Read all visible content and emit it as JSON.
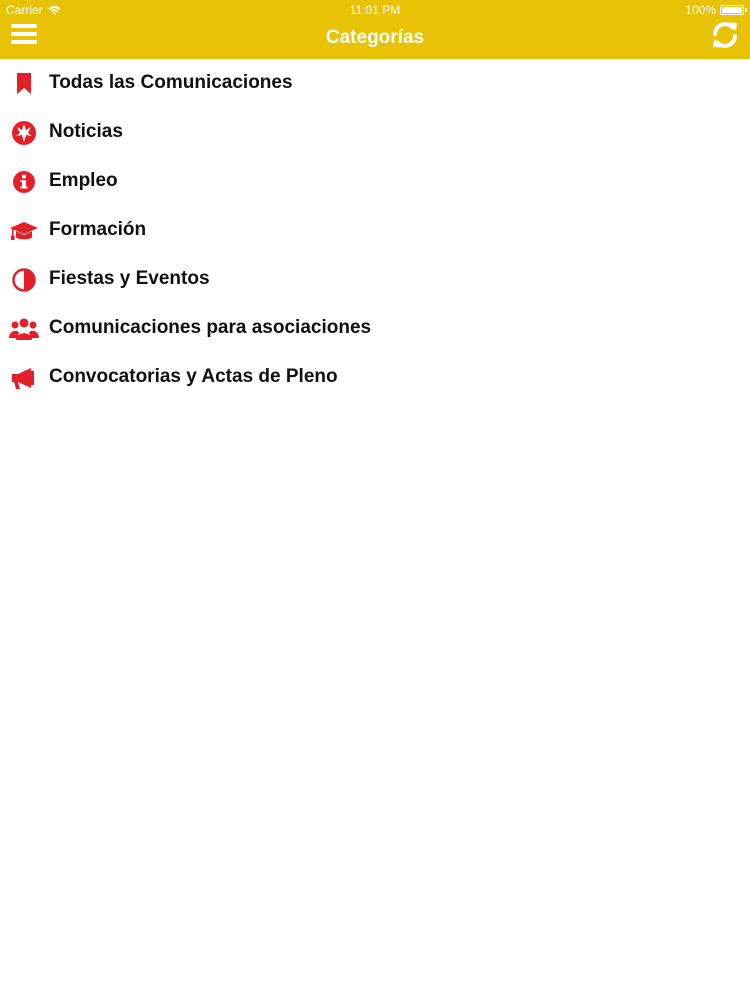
{
  "status_bar": {
    "carrier": "Carrier",
    "time": "11:01 PM",
    "battery": "100%"
  },
  "navbar": {
    "title": "Categorías",
    "menu_icon": "hamburger-menu-icon",
    "refresh_icon": "refresh-icon"
  },
  "colors": {
    "accent": "#E8C204",
    "icon": "#E3202A",
    "text": "#111111"
  },
  "categories": [
    {
      "label": "Todas las Comunicaciones",
      "icon": "bookmark-icon"
    },
    {
      "label": "Noticias",
      "icon": "rebel-emblem-icon"
    },
    {
      "label": "Empleo",
      "icon": "info-circle-icon"
    },
    {
      "label": "Formación",
      "icon": "graduation-cap-icon"
    },
    {
      "label": "Fiestas y Eventos",
      "icon": "half-circle-icon"
    },
    {
      "label": "Comunicaciones para asociaciones",
      "icon": "users-group-icon"
    },
    {
      "label": "Convocatorias y Actas de Pleno",
      "icon": "megaphone-icon"
    }
  ]
}
